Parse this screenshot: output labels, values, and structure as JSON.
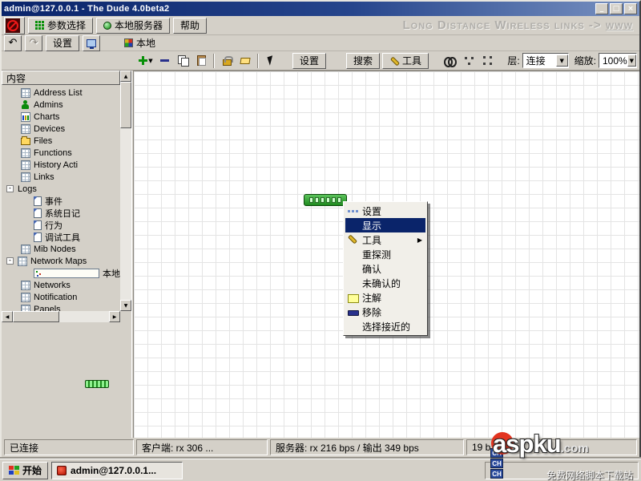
{
  "window": {
    "title": "admin@127.0.0.1 - The Dude 4.0beta2",
    "minimize": "_",
    "maximize": "□",
    "close": "×"
  },
  "menubar": {
    "buttons": [
      {
        "label": "参数选择"
      },
      {
        "label": "本地服务器"
      },
      {
        "label": "帮助"
      }
    ],
    "watermark": "Long Distance Wireless links -> ",
    "watermark_link": "www"
  },
  "toolbar2": {
    "settings": "设置",
    "map_tab": "本地"
  },
  "map_toolbar": {
    "settings": "设置",
    "search": "搜索",
    "tools": "工具",
    "layer_label": "层:",
    "layer_value": "连接",
    "zoom_label": "缩放:",
    "zoom_value": "100%"
  },
  "sidebar": {
    "header": "内容",
    "items": [
      {
        "label": "Address List",
        "level": 1,
        "icon": "table"
      },
      {
        "label": "Admins",
        "level": 1,
        "icon": "person"
      },
      {
        "label": "Charts",
        "level": 1,
        "icon": "chart"
      },
      {
        "label": "Devices",
        "level": 1,
        "icon": "table"
      },
      {
        "label": "Files",
        "level": 1,
        "icon": "folder"
      },
      {
        "label": "Functions",
        "level": 1,
        "icon": "table"
      },
      {
        "label": "History Acti",
        "level": 1,
        "icon": "table"
      },
      {
        "label": "Links",
        "level": 1,
        "icon": "table"
      },
      {
        "label": "Logs",
        "level": 0,
        "expand": "minus"
      },
      {
        "label": "事件",
        "level": 2,
        "icon": "page"
      },
      {
        "label": "系统日记",
        "level": 2,
        "icon": "page"
      },
      {
        "label": "行为",
        "level": 2,
        "icon": "page"
      },
      {
        "label": "调试工具",
        "level": 2,
        "icon": "page"
      },
      {
        "label": "Mib Nodes",
        "level": 1,
        "icon": "table"
      },
      {
        "label": "Network Maps",
        "level": 0,
        "expand": "minus",
        "icon": "table"
      },
      {
        "label": "本地",
        "level": 2,
        "icon": "map"
      },
      {
        "label": "Networks",
        "level": 1,
        "icon": "table"
      },
      {
        "label": "Notification",
        "level": 1,
        "icon": "table"
      },
      {
        "label": "Panels",
        "level": 1,
        "icon": "table"
      }
    ]
  },
  "map": {
    "led_count": 6,
    "device_color": "#1e8a1e",
    "led_color": "#ccffcc"
  },
  "context_menu": {
    "items": [
      {
        "label": "设置",
        "icon": "settings"
      },
      {
        "label": "显示",
        "selected": true
      },
      {
        "label": "工具",
        "icon": "tools",
        "submenu": true
      },
      {
        "label": "重探测"
      },
      {
        "label": "确认"
      },
      {
        "label": "未确认的"
      },
      {
        "label": "注解",
        "icon": "note"
      },
      {
        "label": "移除",
        "icon": "remove"
      },
      {
        "label": "选择接近的"
      }
    ]
  },
  "statusbar": {
    "connection": "已连接",
    "client": "客户端: rx 306 ...",
    "server": "服务器: rx 216 bps / 输出 349 bps",
    "extra": "19 b"
  },
  "taskbar": {
    "start": "开始",
    "task": "admin@127.0.0.1...",
    "ime": "CH"
  },
  "watermarks": {
    "brand": "aspku",
    "brand_suffix": ".com",
    "site": "免费网络脚本下载站"
  },
  "icons": {
    "undo": "↶",
    "redo": "↷",
    "down_arrow": "▼",
    "up_arrow": "▲",
    "left_arrow": "◀",
    "right_arrow": "▶",
    "submenu_arrow": "▶",
    "expander": "-"
  }
}
